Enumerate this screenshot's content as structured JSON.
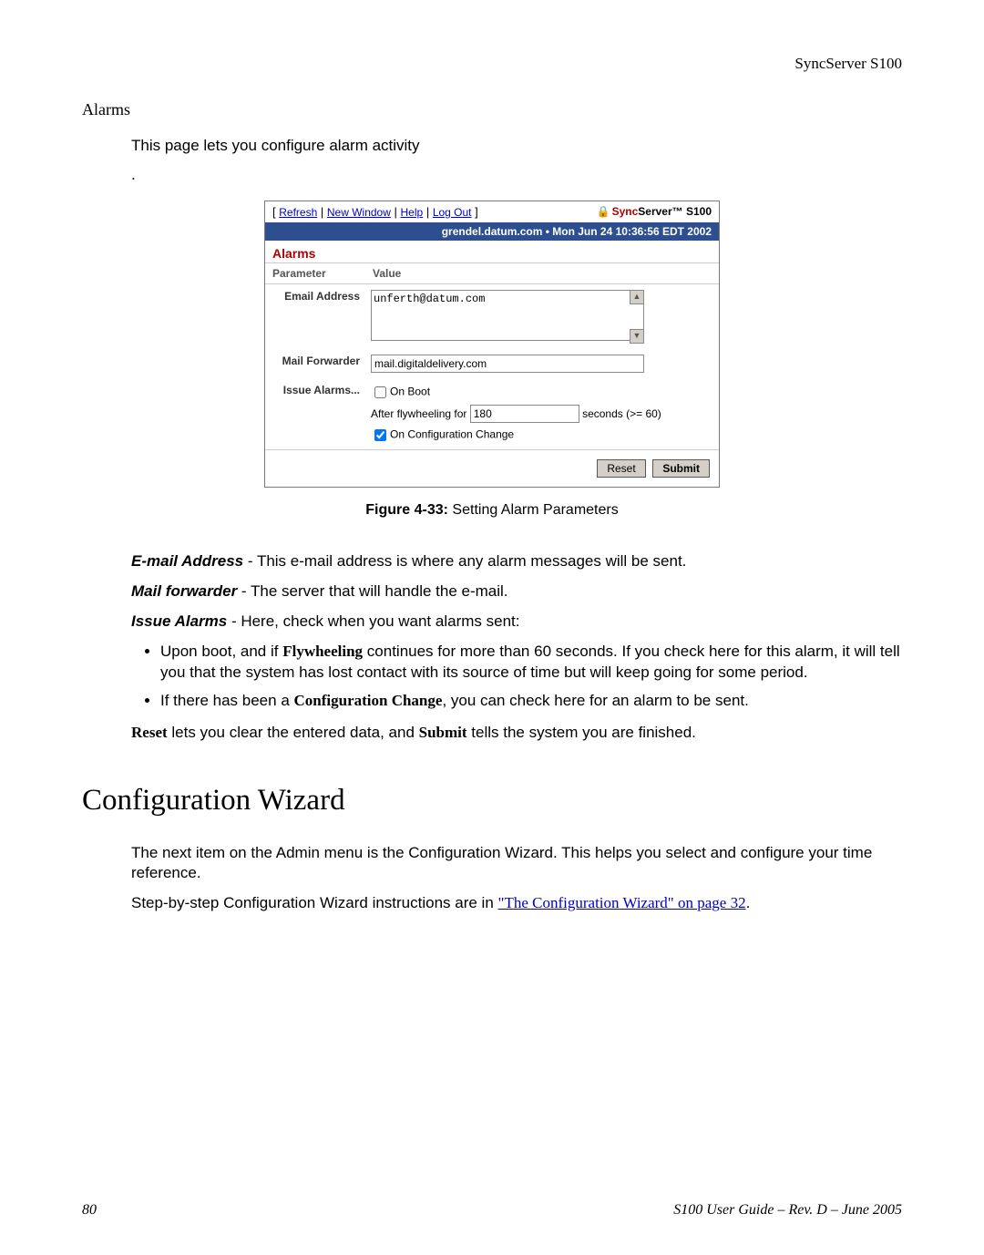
{
  "header": {
    "product": "SyncServer S100"
  },
  "alarms_section": {
    "heading": "Alarms",
    "intro": "This page lets you configure alarm activity",
    "dot": "."
  },
  "shot": {
    "crumbs": {
      "refresh": "Refresh",
      "new_window": "New Window",
      "help": "Help",
      "logout": "Log Out"
    },
    "brand_prefix_red": "Sync",
    "brand_prefix_blk": "Server™ S100",
    "bar": "grendel.datum.com  •  Mon Jun 24 10:36:56 EDT 2002",
    "panel_title": "Alarms",
    "col_param": "Parameter",
    "col_value": "Value",
    "row_email": "Email Address",
    "email_value": "unferth@datum.com",
    "row_mail": "Mail Forwarder",
    "mail_value": "mail.digitaldelivery.com",
    "row_issue": "Issue Alarms...",
    "onboot": "On Boot",
    "fly_prefix": "After flywheeling for",
    "fly_value": "180",
    "fly_suffix": "seconds (>= 60)",
    "conf_change": "On Configuration Change",
    "reset": "Reset",
    "submit": "Submit"
  },
  "figure": {
    "label": "Figure 4-33:",
    "caption": "Setting Alarm Parameters"
  },
  "desc": {
    "email_term": "E-mail Address",
    "email_rest": " - This e-mail address is where any alarm messages will be sent.",
    "mail_term": "Mail forwarder",
    "mail_rest": " - The server that will handle the e-mail.",
    "issue_term": "Issue Alarms",
    "issue_rest": " - Here, check when you want alarms sent:",
    "b1_pre": "Upon boot, and if ",
    "b1_bold": "Flywheeling",
    "b1_post": " continues for more than 60 seconds. If you check here for this alarm, it will tell you that the system has lost contact with its source of time but will keep going for some period.",
    "b2_pre": "If there has been a ",
    "b2_bold": "Configuration Change",
    "b2_post": ", you can check here for an alarm to be sent.",
    "reset_bold": "Reset",
    "reset_mid": " lets you clear the entered data, and ",
    "submit_bold": "Submit",
    "reset_post": " tells the system you are finished."
  },
  "wizard": {
    "heading": "Configuration Wizard",
    "p1": "The next item on the Admin menu is the Configuration Wizard. This helps you select and configure your time reference.",
    "p2_pre": "Step-by-step Configuration Wizard instructions are in ",
    "p2_link": "\"The Configuration Wizard\" on page 32",
    "p2_post": "."
  },
  "footer": {
    "left": "80",
    "right": "S100 User Guide – Rev. D – June 2005"
  }
}
